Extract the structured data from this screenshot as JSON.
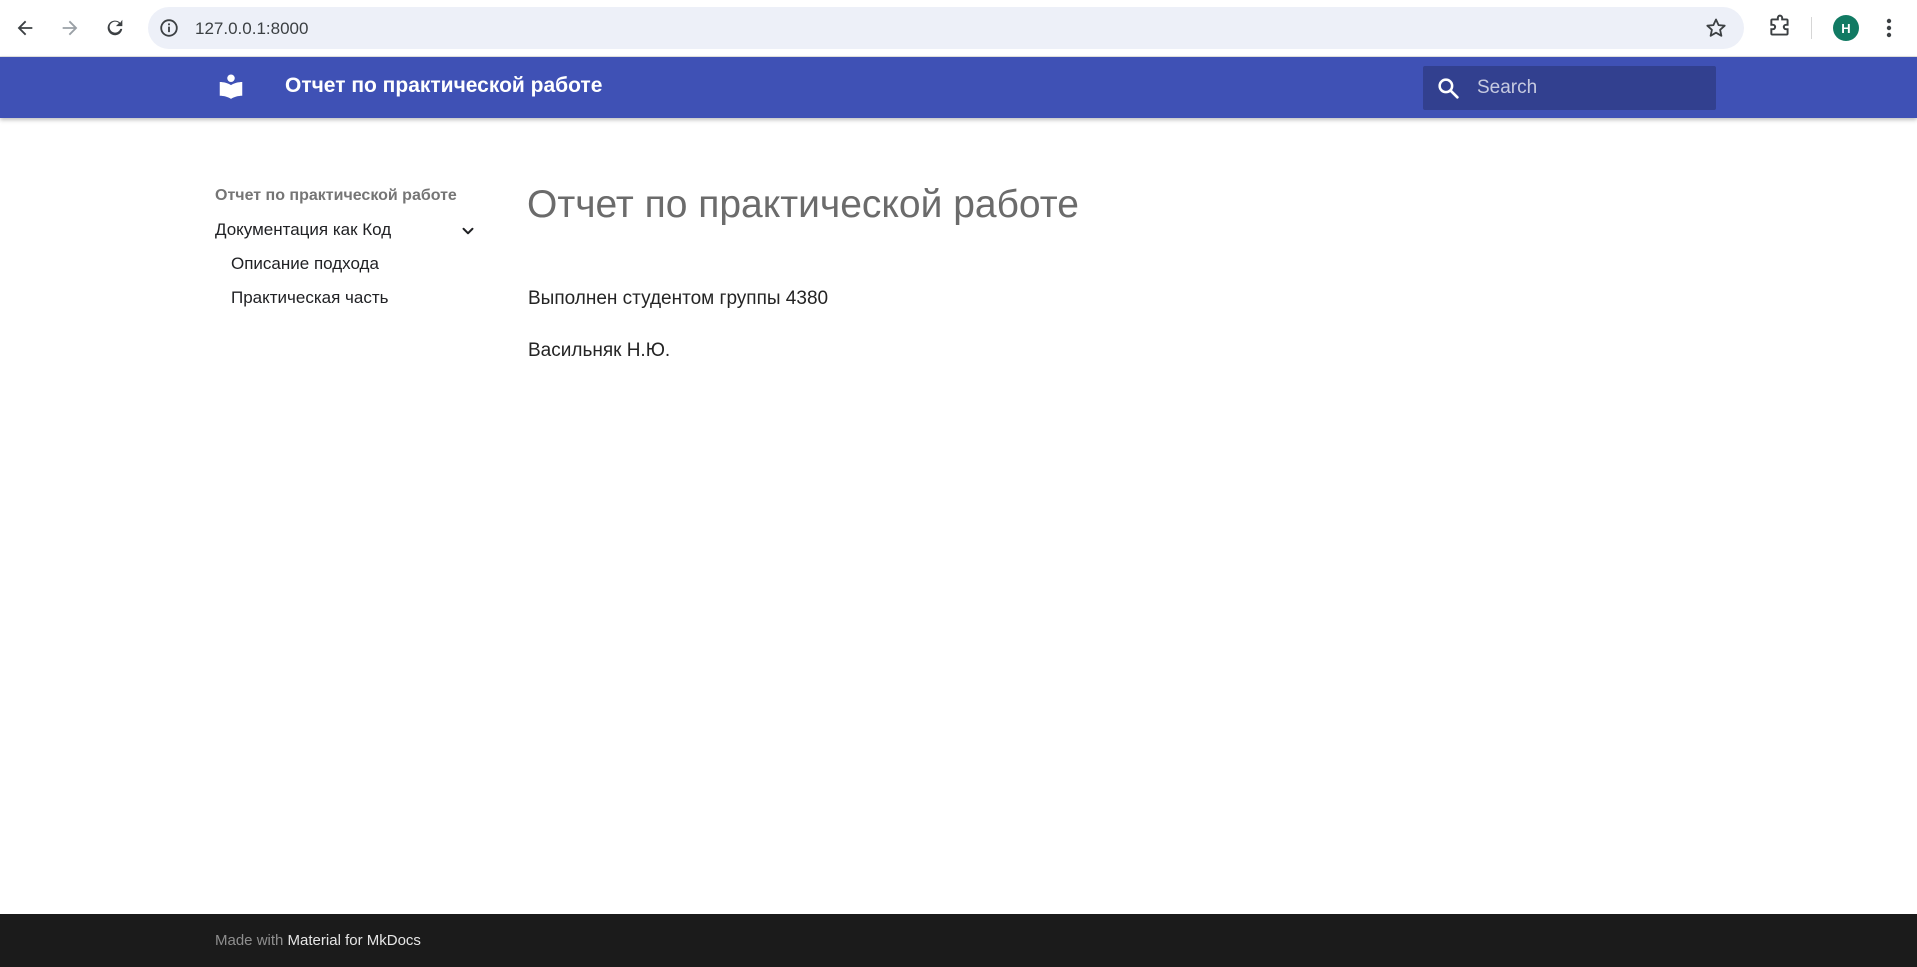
{
  "browser": {
    "url": "127.0.0.1:8000",
    "profile_initial": "H",
    "profile_color": "#117a63",
    "icons": [
      "back-icon",
      "forward-icon",
      "reload-icon",
      "info-icon",
      "star-icon",
      "extensions-icon",
      "more-icon"
    ]
  },
  "header": {
    "title": "Отчет по практической работе",
    "background": "#3f51b5",
    "logo_icon": "book-reader-icon",
    "search": {
      "placeholder": "Search",
      "icon": "search-icon"
    }
  },
  "sidebar": {
    "items": [
      {
        "label": "Отчет по практической работе",
        "active": true
      },
      {
        "label": "Документация как Код",
        "expanded": true,
        "icon": "chevron-down-icon",
        "children": [
          {
            "label": "Описание подхода"
          },
          {
            "label": "Практическая часть"
          }
        ]
      }
    ]
  },
  "main": {
    "title": "Отчет по практической работе",
    "paragraphs": [
      "Выполнен студентом группы 4380",
      "Васильняк Н.Ю."
    ]
  },
  "footer": {
    "prefix": "Made with",
    "link": "Material for MkDocs"
  }
}
